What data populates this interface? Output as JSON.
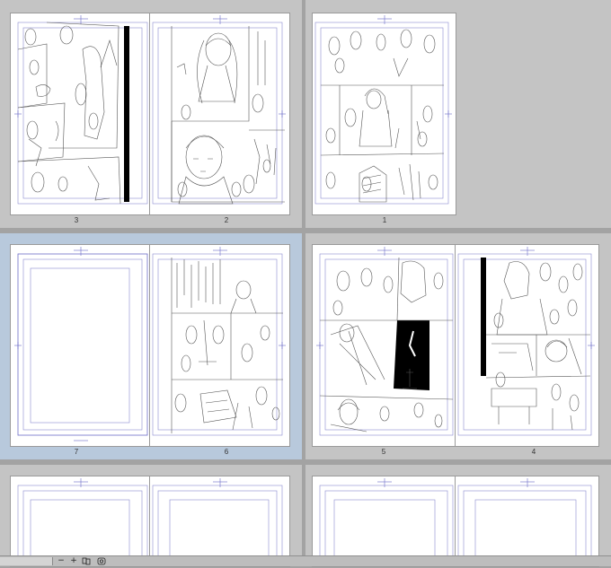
{
  "spreads": [
    {
      "left_page": "3",
      "right_page": "2"
    },
    {
      "left_page": "",
      "right_page": "1"
    },
    {
      "left_page": "7",
      "right_page": "6"
    },
    {
      "left_page": "5",
      "right_page": "4"
    },
    {
      "left_page": "",
      "right_page": ""
    },
    {
      "left_page": "",
      "right_page": ""
    }
  ],
  "statusbar": {
    "zoom_out_label": "−",
    "zoom_in_label": "+"
  },
  "colors": {
    "guide": "#6b6bc8",
    "sketch": "#555555",
    "selected_cell": "#b8c9dc"
  }
}
